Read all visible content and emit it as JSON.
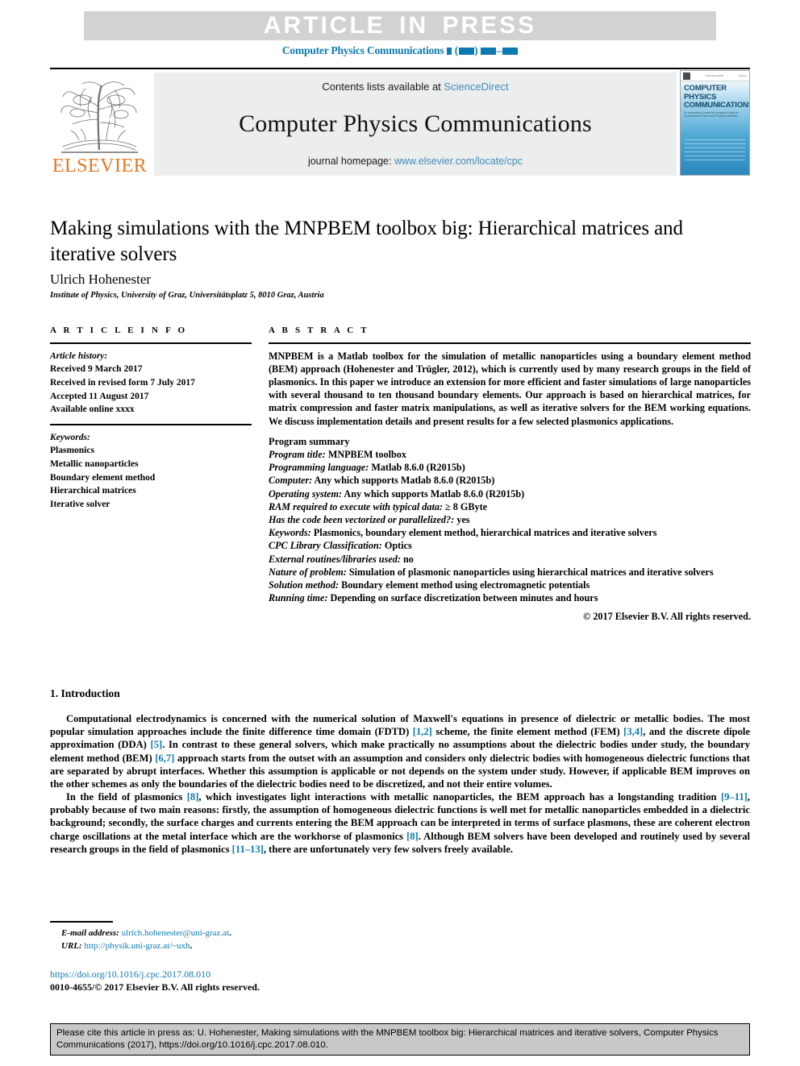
{
  "banner": {
    "text": "ARTICLE IN PRESS"
  },
  "running_head": {
    "journal": "Computer Physics Communications"
  },
  "masthead": {
    "contents_prefix": "Contents lists available at ",
    "sciencedirect": "ScienceDirect",
    "journal_title": "Computer Physics Communications",
    "homepage_prefix": "journal homepage: ",
    "homepage_url": "www.elsevier.com/locate/cpc",
    "publisher": "ELSEVIER",
    "cover": {
      "title": "COMPUTER PHYSICS COMMUNICATIONS",
      "subtitle": "An International Journal and program Library for Computational Physics and Physical Chemistry",
      "strip_left": "ISSN 0010-4655",
      "strip_right": "Volume"
    },
    "accent_blue": "#3c8dbc",
    "link_blue": "#0c7ab0",
    "elsevier_orange": "#e87722"
  },
  "article": {
    "title": "Making simulations with the MNPBEM toolbox big: Hierarchical matrices and iterative solvers",
    "author": "Ulrich Hohenester",
    "affiliation": "Institute of Physics, University of Graz, Universitätsplatz 5, 8010 Graz, Austria"
  },
  "info": {
    "heading": "A R T I C L E   I N F O",
    "history_label": "Article history:",
    "history": [
      "Received 9 March 2017",
      "Received in revised form 7 July 2017",
      "Accepted 11 August 2017",
      "Available online xxxx"
    ],
    "keywords_label": "Keywords:",
    "keywords": [
      "Plasmonics",
      "Metallic nanoparticles",
      "Boundary element method",
      "Hierarchical matrices",
      "Iterative solver"
    ]
  },
  "abstract": {
    "heading": "A B S T R A C T",
    "body": "MNPBEM is a Matlab toolbox for the simulation of metallic nanoparticles using a boundary element method (BEM) approach (Hohenester and Trügler, 2012), which is currently used by many research groups in the field of plasmonics. In this paper we introduce an extension for more efficient and faster simulations of large nanoparticles with several thousand to ten thousand boundary elements. Our approach is based on hierarchical matrices, for matrix compression and faster matrix manipulations, as well as iterative solvers for the BEM working equations. We discuss implementation details and present results for a few selected plasmonics applications.",
    "program_summary_heading": "Program summary",
    "program_summary": [
      {
        "label": "Program title:",
        "value": " MNPBEM toolbox"
      },
      {
        "label": "Programming language:",
        "value": " Matlab 8.6.0 (R2015b)"
      },
      {
        "label": "Computer:",
        "value": " Any which supports Matlab 8.6.0 (R2015b)"
      },
      {
        "label": "Operating system:",
        "value": " Any which supports Matlab 8.6.0 (R2015b)"
      },
      {
        "label": "RAM required to execute with typical data:",
        "value": " ≥ 8 GByte"
      },
      {
        "label": "Has the code been vectorized or parallelized?:",
        "value": " yes"
      },
      {
        "label": "Keywords:",
        "value": " Plasmonics, boundary element method, hierarchical matrices and iterative solvers"
      },
      {
        "label": "CPC Library Classification:",
        "value": " Optics"
      },
      {
        "label": "External routines/libraries used:",
        "value": " no"
      },
      {
        "label": "Nature of problem:",
        "value": " Simulation of plasmonic nanoparticles using hierarchical matrices and iterative solvers"
      },
      {
        "label": "Solution method:",
        "value": " Boundary element method using electromagnetic potentials"
      },
      {
        "label": "Running time:",
        "value": " Depending on surface discretization between minutes and hours"
      }
    ],
    "copyright": "© 2017 Elsevier B.V. All rights reserved."
  },
  "introduction": {
    "heading": "1. Introduction",
    "paragraph1_parts": [
      {
        "t": "Computational electrodynamics is concerned with the numerical solution of Maxwell's equations in presence of dielectric or metallic bodies. The most popular simulation approaches include the finite difference time domain (FDTD) "
      },
      {
        "t": "[1,2]",
        "cite": true
      },
      {
        "t": " scheme, the finite element method (FEM) "
      },
      {
        "t": "[3,4]",
        "cite": true
      },
      {
        "t": ", and the discrete dipole approximation (DDA) "
      },
      {
        "t": "[5]",
        "cite": true
      },
      {
        "t": ". In contrast to these general solvers, which make practically no assumptions about the dielectric bodies under study, the boundary element method (BEM) "
      },
      {
        "t": "[6,7]",
        "cite": true
      },
      {
        "t": " approach starts from the outset with an assumption and considers only dielectric bodies with homogeneous dielectric functions that are separated by abrupt interfaces. Whether this assumption is applicable or not depends on the system under study. However, if applicable BEM improves on the other schemes as only the boundaries of the dielectric bodies need to be discretized, and not their entire volumes."
      }
    ],
    "paragraph2_parts": [
      {
        "t": "In the field of plasmonics "
      },
      {
        "t": "[8]",
        "cite": true
      },
      {
        "t": ", which investigates light interactions with metallic nanoparticles, the BEM approach has a longstanding tradition "
      },
      {
        "t": "[9–11]",
        "cite": true
      },
      {
        "t": ", probably because of two main reasons: firstly, the assumption of homogeneous dielectric functions is well met for metallic nanoparticles embedded in a dielectric background; secondly, the surface charges and currents entering the BEM approach can be interpreted in terms of surface plasmons, these are coherent electron charge oscillations at the metal interface which are the workhorse of plasmonics "
      },
      {
        "t": "[8]",
        "cite": true
      },
      {
        "t": ". Although BEM solvers have been developed and routinely used by several research groups in the field of plasmonics "
      },
      {
        "t": "[11–13]",
        "cite": true
      },
      {
        "t": ", there are unfortunately very few solvers freely available."
      }
    ]
  },
  "footnote": {
    "email_label": "E-mail address:",
    "email": " ulrich.hohenester@uni-graz.at",
    "email_suffix": ".",
    "url_label": "URL:",
    "url": " http://physik.uni-graz.at/~uxh",
    "url_suffix": ".",
    "doi": "https://doi.org/10.1016/j.cpc.2017.08.010",
    "issn": "0010-4655/© 2017 Elsevier B.V. All rights reserved."
  },
  "cite_box": {
    "text": "Please cite this article in press as: U. Hohenester, Making simulations with the MNPBEM toolbox big: Hierarchical matrices and iterative solvers, Computer Physics Communications (2017), https://doi.org/10.1016/j.cpc.2017.08.010."
  }
}
